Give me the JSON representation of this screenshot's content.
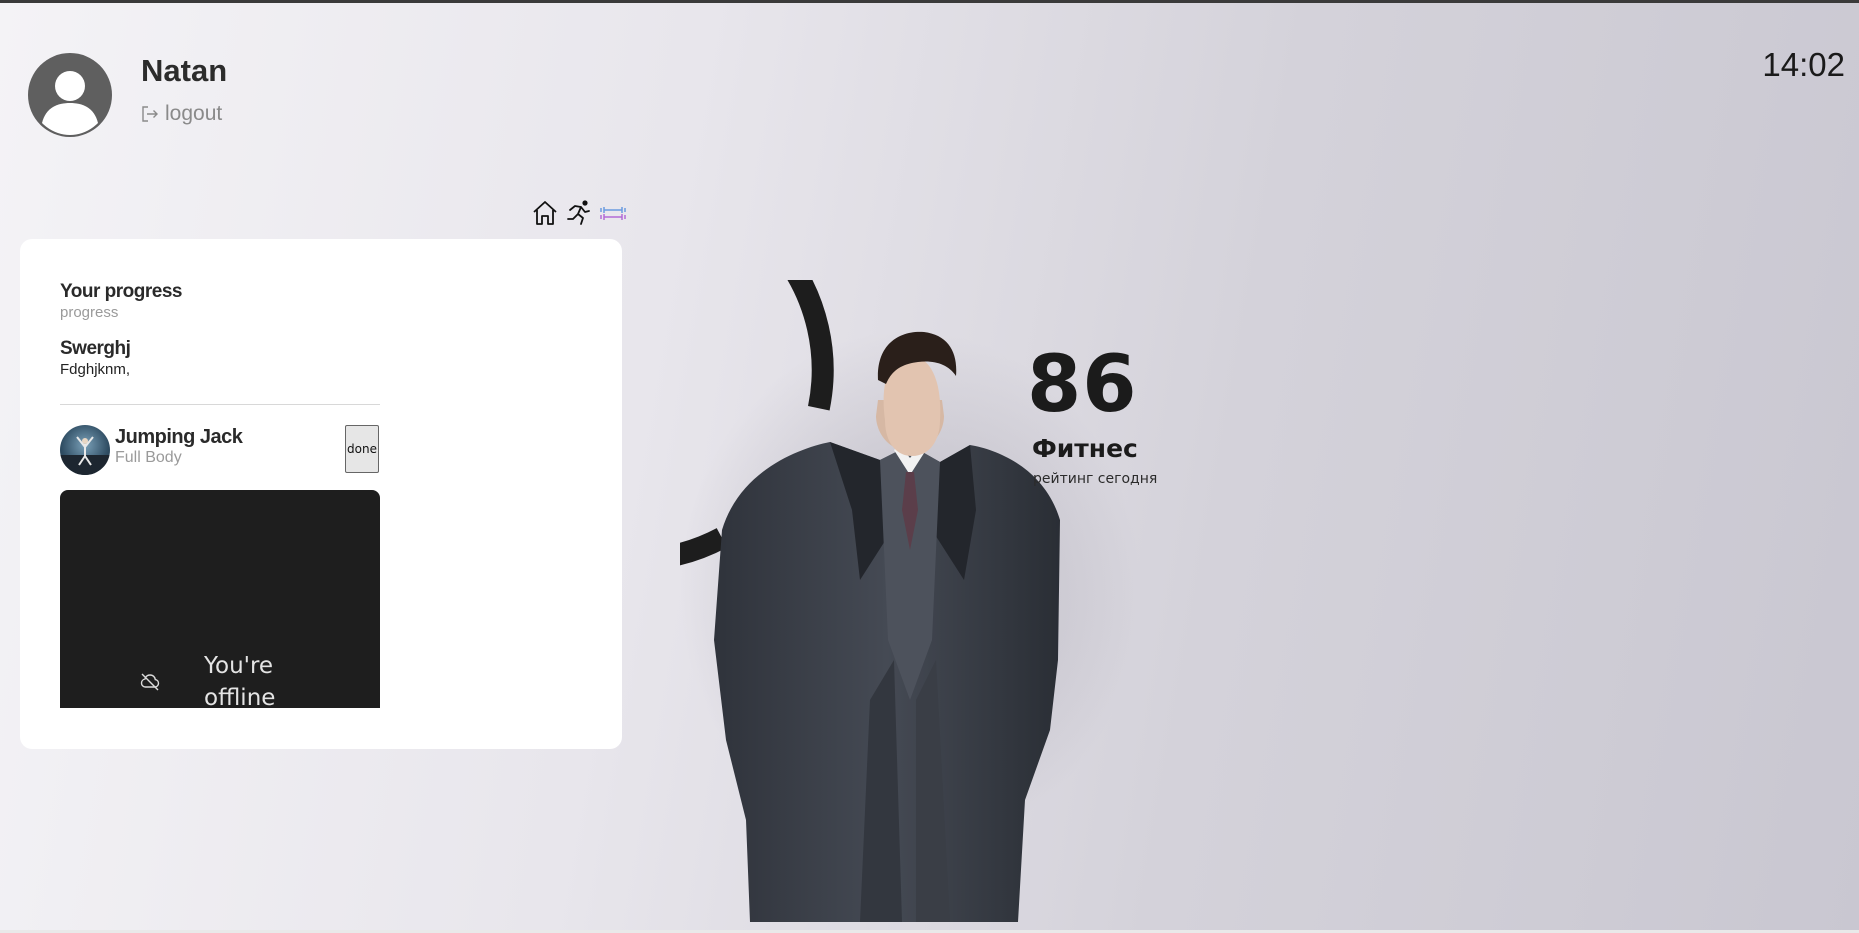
{
  "header": {
    "user_name": "Natan",
    "logout_label": "logout",
    "clock": "14:02"
  },
  "nav": {
    "icons": [
      "home-icon",
      "running-icon",
      "dumbbell-icon"
    ]
  },
  "progress_card": {
    "title": "Your progress",
    "subtitle": "progress",
    "item_title": "Swerghj",
    "item_subtitle": "Fdghjknm,",
    "exercise": {
      "name": "Jumping Jack",
      "category": "Full Body",
      "done_label": "done"
    },
    "video": {
      "status_text": "You're offline",
      "status_icon": "cloud-off-icon"
    }
  },
  "rating": {
    "value": "86",
    "label": "Фитнес",
    "sublabel": "рейтинг сегодня",
    "ring_fraction": 0.86
  },
  "colors": {
    "ring": "#1d1d1d",
    "accent_dumbbell": "#b36bd6"
  }
}
